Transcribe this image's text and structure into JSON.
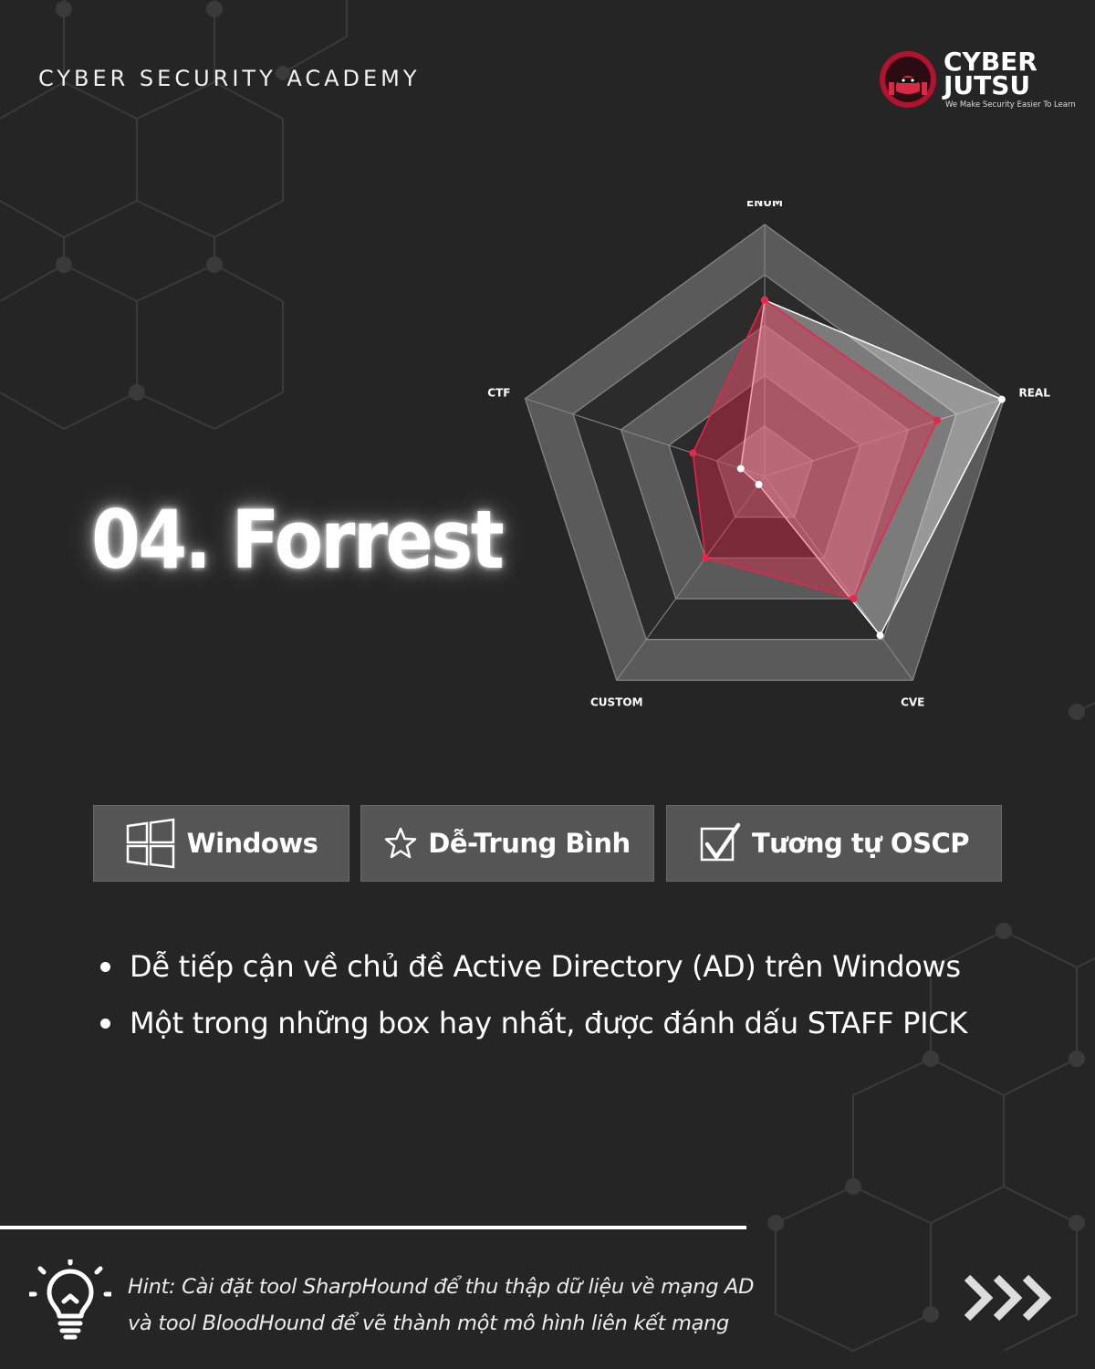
{
  "header": {
    "academy_label": "CYBER SECURITY ACADEMY",
    "logo_word_1": "CYBER",
    "logo_word_2": "JUTSU",
    "logo_tagline": "We Make Security Easier To Learn",
    "logo_badge_text": "CYBER JUTSU"
  },
  "title": "04. Forrest",
  "colors": {
    "background": "#252525",
    "accent_red": "#e8254a",
    "panel_gray": "#555555"
  },
  "radar": {
    "axes": [
      "ENUM",
      "REAL",
      "CVE",
      "CUSTOM",
      "CTF"
    ],
    "levels": 5,
    "series": [
      {
        "values": [
          0.7,
          0.99,
          0.78,
          0.04,
          0.1
        ],
        "stroke": "#ffffff",
        "fill": "rgba(255,255,255,0.38)",
        "point": "#ffffff"
      },
      {
        "values": [
          0.7,
          0.72,
          0.6,
          0.4,
          0.3
        ],
        "stroke": "#e8254a",
        "fill": "rgba(232,37,74,0.42)",
        "point": "#e8254a"
      }
    ]
  },
  "tags": {
    "os": {
      "label": "Windows",
      "icon": "windows-icon"
    },
    "difficulty": {
      "label": "Dễ-Trung Bình",
      "icon": "star-icon"
    },
    "similar": {
      "label": "Tương tự OSCP",
      "icon": "checkbox-icon"
    }
  },
  "bullets": [
    "Dễ tiếp cận về chủ đề Active Directory (AD) trên Windows",
    "Một trong những box hay nhất, được đánh dấu STAFF PICK"
  ],
  "hint": {
    "line1": "Hint: Cài đặt tool SharpHound để thu thập dữ liệu về mạng AD",
    "line2": "và tool BloodHound để vẽ thành một mô hình liên kết mạng",
    "icon": "lightbulb-icon"
  },
  "next_icon": "triple-chevron-right-icon"
}
